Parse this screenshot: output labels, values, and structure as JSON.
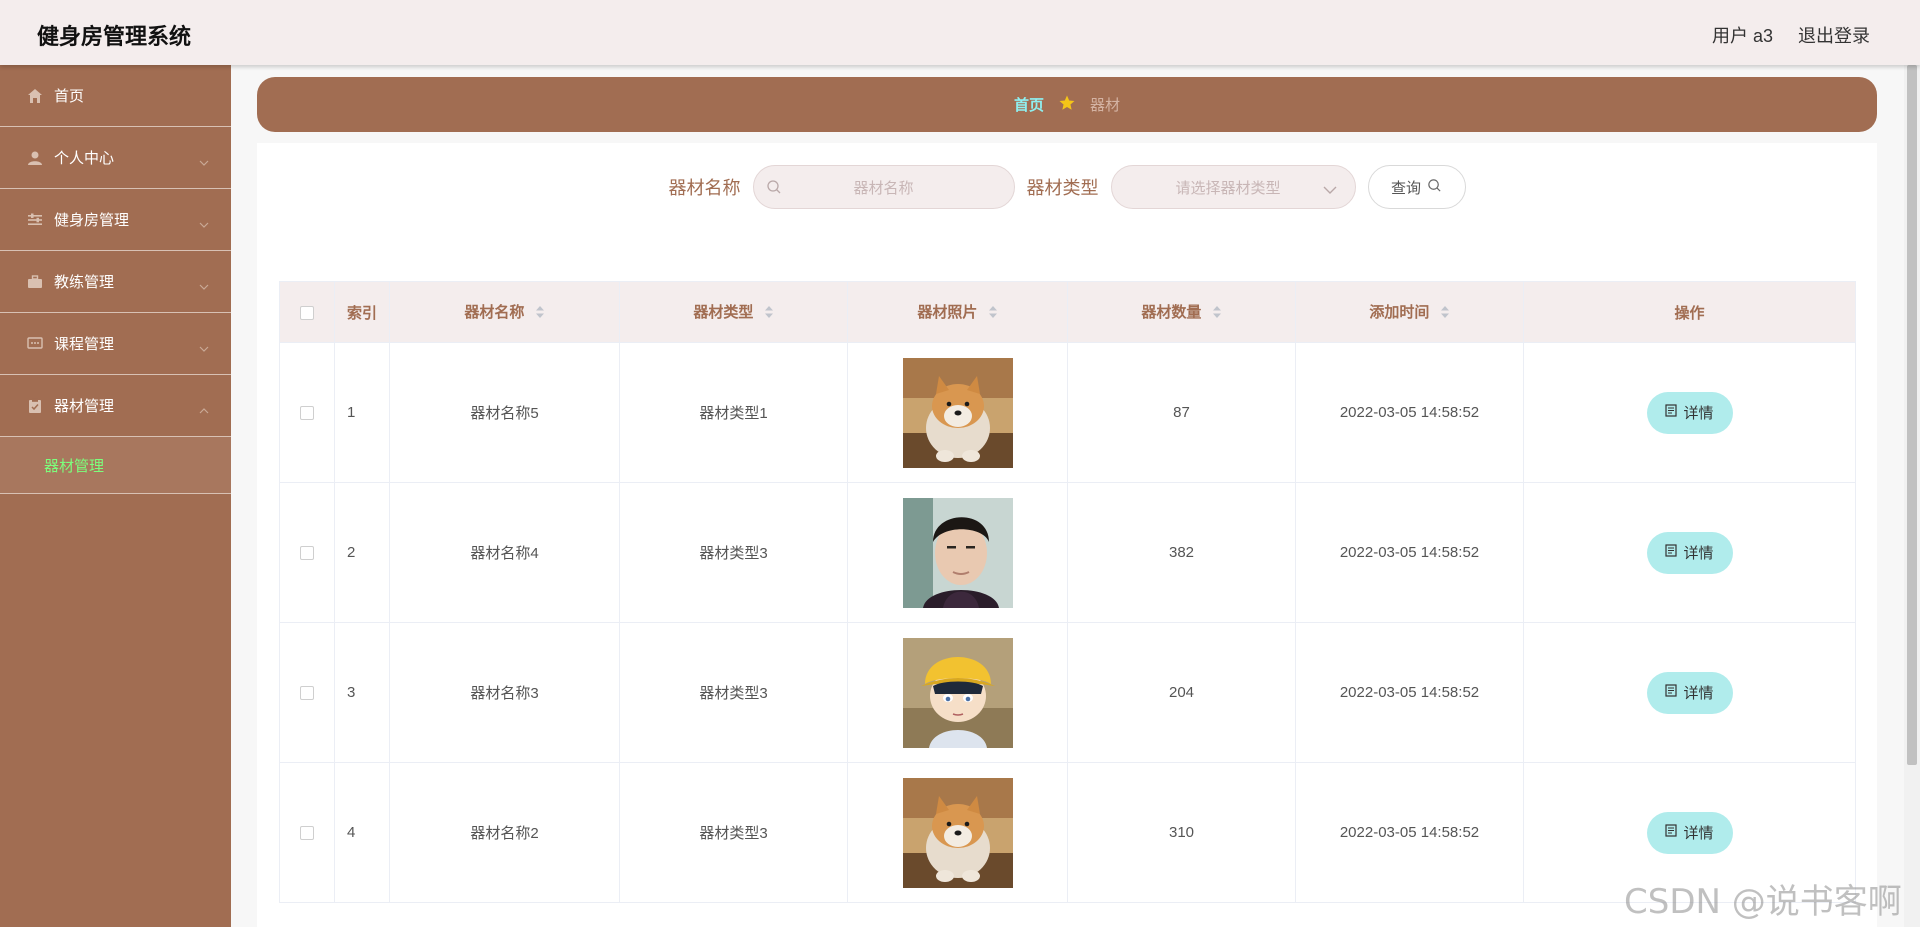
{
  "header": {
    "title": "健身房管理系统",
    "user": "用户 a3",
    "logout": "退出登录"
  },
  "sidebar": {
    "items": [
      {
        "label": "首页",
        "icon": "home-icon"
      },
      {
        "label": "个人中心",
        "icon": "user-icon"
      },
      {
        "label": "健身房管理",
        "icon": "sliders-icon"
      },
      {
        "label": "教练管理",
        "icon": "briefcase-icon"
      },
      {
        "label": "课程管理",
        "icon": "chat-icon"
      },
      {
        "label": "器材管理",
        "icon": "clipboard-icon"
      }
    ],
    "subitem": "器材管理"
  },
  "breadcrumb": {
    "home": "首页",
    "current": "器材"
  },
  "search": {
    "name_label": "器材名称",
    "name_placeholder": "器材名称",
    "type_label": "器材类型",
    "type_placeholder": "请选择器材类型",
    "query_label": "查询"
  },
  "table": {
    "headers": {
      "index": "索引",
      "name": "器材名称",
      "type": "器材类型",
      "photo": "器材照片",
      "qty": "器材数量",
      "time": "添加时间",
      "ops": "操作"
    },
    "rows": [
      {
        "index": "1",
        "name": "器材名称5",
        "type": "器材类型1",
        "photo": "shiba-dog-photo",
        "qty": "87",
        "time": "2022-03-05 14:58:52",
        "action": "详情"
      },
      {
        "index": "2",
        "name": "器材名称4",
        "type": "器材类型3",
        "photo": "man-portrait-photo",
        "qty": "382",
        "time": "2022-03-05 14:58:52",
        "action": "详情"
      },
      {
        "index": "3",
        "name": "器材名称3",
        "type": "器材类型3",
        "photo": "anime-boy-yellow-hat-photo",
        "qty": "204",
        "time": "2022-03-05 14:58:52",
        "action": "详情"
      },
      {
        "index": "4",
        "name": "器材名称2",
        "type": "器材类型3",
        "photo": "shiba-dog-photo",
        "qty": "310",
        "time": "2022-03-05 14:58:52",
        "action": "详情"
      }
    ]
  },
  "watermark": "CSDN @说书客啊",
  "colors": {
    "brand": "#a16d52",
    "header_bg": "#f4eded",
    "active_sub": "#7cff7c",
    "detail_btn": "#b0ecec"
  }
}
